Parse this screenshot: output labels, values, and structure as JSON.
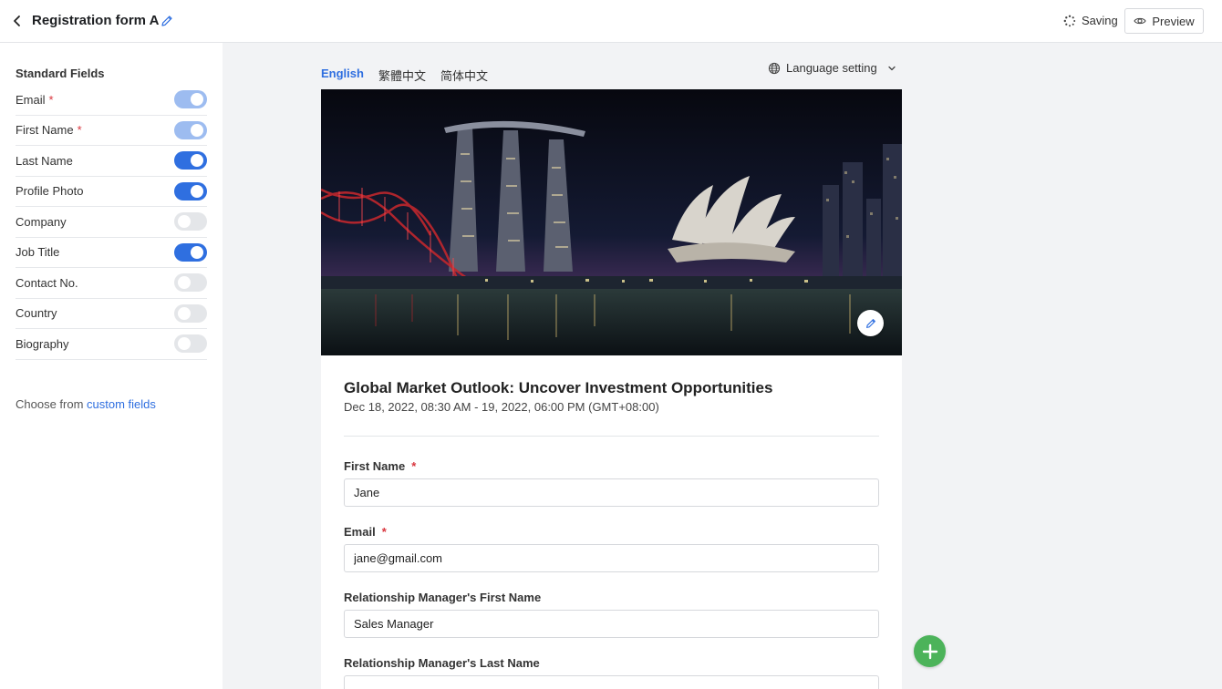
{
  "header": {
    "form_title": "Registration form A",
    "saving_label": "Saving",
    "preview_label": "Preview"
  },
  "sidebar": {
    "heading": "Standard Fields",
    "fields": [
      {
        "label": "Email",
        "required": true,
        "enabled": true,
        "locked": true
      },
      {
        "label": "First Name",
        "required": true,
        "enabled": true,
        "locked": true
      },
      {
        "label": "Last Name",
        "required": false,
        "enabled": true,
        "locked": false
      },
      {
        "label": "Profile Photo",
        "required": false,
        "enabled": true,
        "locked": false
      },
      {
        "label": "Company",
        "required": false,
        "enabled": false,
        "locked": false
      },
      {
        "label": "Job Title",
        "required": false,
        "enabled": true,
        "locked": false
      },
      {
        "label": "Contact No.",
        "required": false,
        "enabled": false,
        "locked": false
      },
      {
        "label": "Country",
        "required": false,
        "enabled": false,
        "locked": false
      },
      {
        "label": "Biography",
        "required": false,
        "enabled": false,
        "locked": false
      }
    ],
    "required_mark": "*",
    "custom_prefix": "Choose from",
    "custom_link": "custom fields"
  },
  "languages": {
    "tabs": [
      "English",
      "繁體中文",
      "简体中文"
    ],
    "active": "English",
    "setting_label": "Language setting"
  },
  "event": {
    "title": "Global Market Outlook: Uncover Investment Opportunities",
    "date": "Dec 18, 2022, 08:30 AM - 19, 2022, 06:00 PM (GMT+08:00)"
  },
  "questions": [
    {
      "label": "First Name",
      "required": true,
      "value": "Jane"
    },
    {
      "label": "Email",
      "required": true,
      "value": "jane@gmail.com"
    },
    {
      "label": "Relationship Manager's First Name",
      "required": false,
      "value": "Sales Manager"
    },
    {
      "label": "Relationship Manager's Last Name",
      "required": false,
      "value": ""
    }
  ],
  "colors": {
    "accent": "#2f6fe0",
    "add_button": "#4cb35a",
    "required": "#d9363e"
  },
  "icons": {
    "back": "chevron-left-icon",
    "edit": "pencil-icon",
    "saving": "spinner-icon",
    "preview": "eye-icon",
    "language": "globe-icon",
    "dropdown": "chevron-down-icon",
    "add": "plus-icon"
  }
}
